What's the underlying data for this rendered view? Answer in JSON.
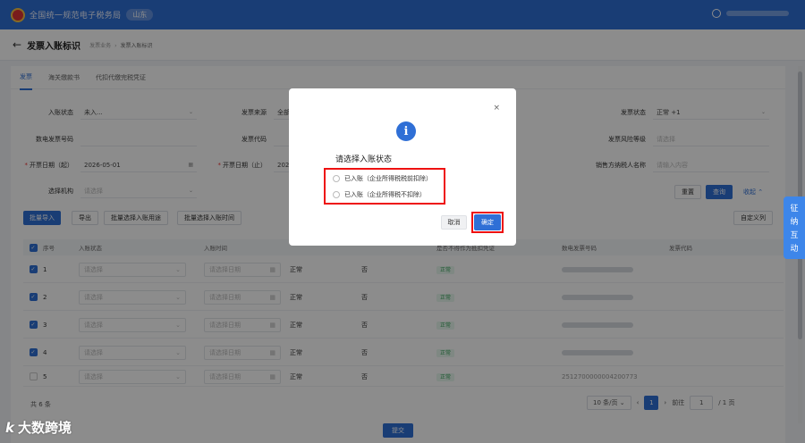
{
  "topbar": {
    "brand": "全国统一规范电子税务局",
    "region": "山东"
  },
  "header": {
    "title": "发票入账标识",
    "crumb_parent": "发票业务",
    "crumb_current": "发票入账标识"
  },
  "tabs": [
    {
      "label": "发票"
    },
    {
      "label": "海关缴款书"
    },
    {
      "label": "代扣代缴完税凭证"
    }
  ],
  "filters": {
    "entry_status": {
      "label": "入账状态",
      "value": "未入..."
    },
    "invoice_source": {
      "label": "发票来源",
      "value": "全部"
    },
    "invoice_status": {
      "label": "发票状态",
      "value": "正常",
      "extra": "+1"
    },
    "digital_number": {
      "label": "数电发票号码"
    },
    "invoice_code": {
      "label": "发票代码"
    },
    "risk_level": {
      "label": "发票风险等级",
      "placeholder": "请选择"
    },
    "date_start": {
      "label": "开票日期（起）",
      "value": "2026-05-01"
    },
    "date_end": {
      "label": "开票日期（止）",
      "value": "2026"
    },
    "seller_name": {
      "label": "销售方纳税人名称",
      "placeholder": "请输入内容"
    },
    "org": {
      "label": "选择机构",
      "placeholder": "请选择"
    }
  },
  "actions": {
    "reset": "重置",
    "query": "查询",
    "collapse": "收起",
    "batch_in": "批量导入",
    "export": "导出",
    "batch_select_use": "批量选择入账用途",
    "batch_select_time": "批量选择入账时间",
    "custom_columns": "自定义列"
  },
  "table": {
    "headers": [
      "序号",
      "入账状态",
      "入账时间",
      "",
      "",
      "",
      "是否不得作为抵扣凭证",
      "数电发票号码",
      "发票代码"
    ],
    "select_placeholder": "请选择",
    "date_placeholder": "请选择日期",
    "rows": [
      {
        "index": "1",
        "status": "正常",
        "flag": "否",
        "tag": "正常",
        "checked": true
      },
      {
        "index": "2",
        "status": "正常",
        "flag": "否",
        "tag": "正常",
        "checked": true
      },
      {
        "index": "3",
        "status": "正常",
        "flag": "否",
        "tag": "正常",
        "checked": true
      },
      {
        "index": "4",
        "status": "正常",
        "flag": "否",
        "tag": "正常",
        "checked": true
      },
      {
        "index": "5",
        "status": "正常",
        "flag": "否",
        "tag": "正常",
        "checked": false
      }
    ],
    "blurred_code": "2512700000004200773"
  },
  "pagination": {
    "total": "共 6 条",
    "page_size": "10 条/页",
    "current": "1",
    "goto_label": "前往",
    "goto_value": "1",
    "total_pages": "/ 1 页"
  },
  "bottom_button": "提交",
  "side_float": {
    "chars": [
      "征",
      "纳",
      "互",
      "动"
    ]
  },
  "watermark": {
    "text": "大数跨境",
    "logo": "k"
  },
  "dialog": {
    "title": "请选择入账状态",
    "options": [
      "已入账（企业所得税税前扣除）",
      "已入账（企业所得税不扣除）"
    ],
    "cancel": "取消",
    "confirm": "确定",
    "close": "×"
  },
  "colors": {
    "brand": "#2f6fd6",
    "highlight": "#ee1111"
  }
}
